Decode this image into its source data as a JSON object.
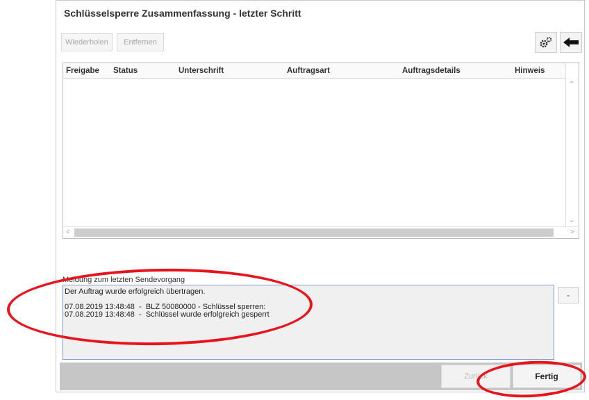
{
  "window": {
    "title": "Schlüsselsperre Zusammenfassung - letzter Schritt"
  },
  "toolbar": {
    "repeat_label": "Wiederholen",
    "remove_label": "Entfernen",
    "settings_icon": "gears-icon",
    "back_icon": "arrow-left-icon"
  },
  "grid": {
    "columns": [
      "Freigabe",
      "Status",
      "Unterschrift",
      "Auftragsart",
      "Auftragsdetails",
      "Hinweis"
    ],
    "rows": []
  },
  "message": {
    "label": "Meldung zum letzten Sendevorgang",
    "lines": [
      "Der Auftrag wurde erfolgreich übertragen.",
      "",
      "07.08.2019 13:48:48  -  BLZ 50080000 - Schlüssel sperren:",
      "07.08.2019 13:48:48  -  Schlüssel wurde erfolgreich gesperrt"
    ],
    "toggle_label": "-"
  },
  "footer": {
    "back_label": "Zurück",
    "done_label": "Fertig"
  },
  "colors": {
    "annotation": "#e8141c",
    "footer_bar": "#c6c6c6",
    "message_border": "#7a9cc8"
  }
}
